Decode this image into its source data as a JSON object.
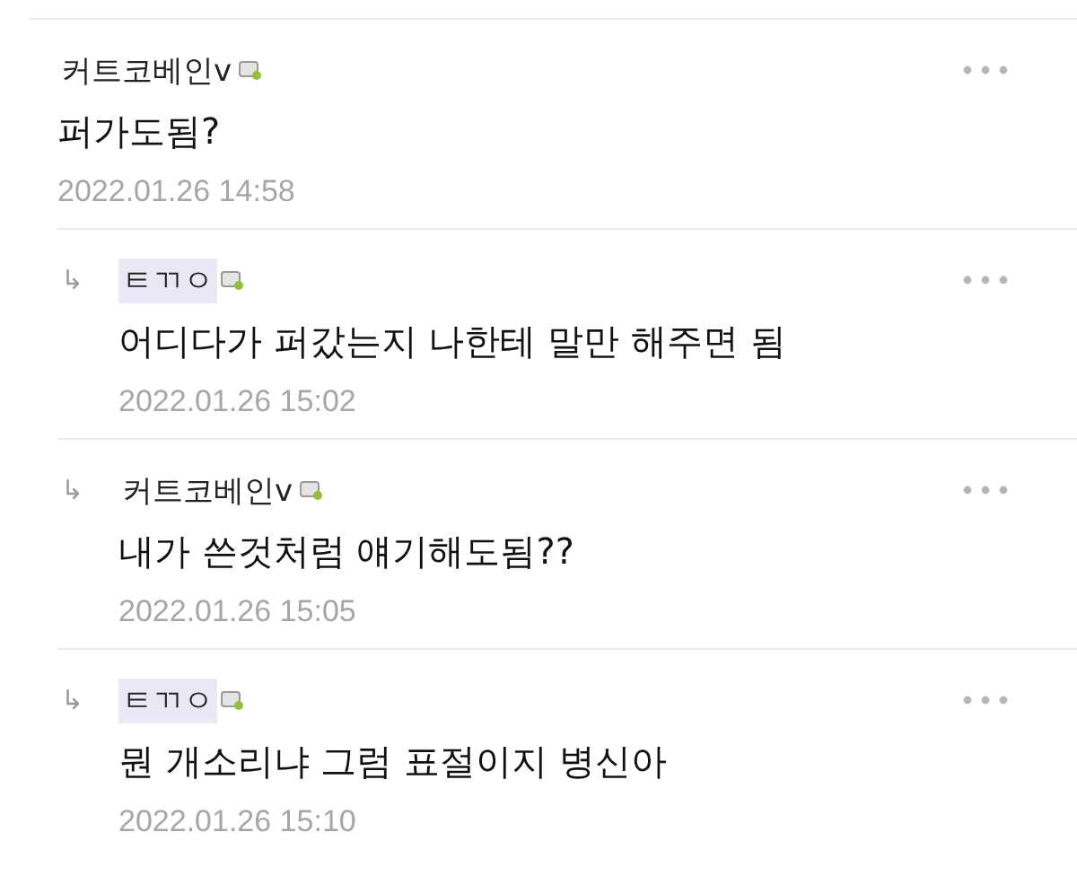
{
  "comments": [
    {
      "kind": "comment",
      "author": "커트코베인v",
      "author_highlighted": false,
      "text": "퍼가도됨?",
      "date": "2022.01.26 14:58"
    },
    {
      "kind": "reply",
      "reply_mark": "↳",
      "author": "ㅌㄲㅇ",
      "author_highlighted": true,
      "text": "어디다가 퍼갔는지 나한테 말만 해주면 됨",
      "date": "2022.01.26 15:02"
    },
    {
      "kind": "reply",
      "reply_mark": "↳",
      "author": "커트코베인v",
      "author_highlighted": false,
      "text": "내가 쓴것처럼 얘기해도됨??",
      "date": "2022.01.26 15:05"
    },
    {
      "kind": "reply",
      "reply_mark": "↳",
      "author": "ㅌㄲㅇ",
      "author_highlighted": true,
      "text": "뭔 개소리냐 그럼 표절이지 병신아",
      "date": "2022.01.26 15:10"
    }
  ]
}
